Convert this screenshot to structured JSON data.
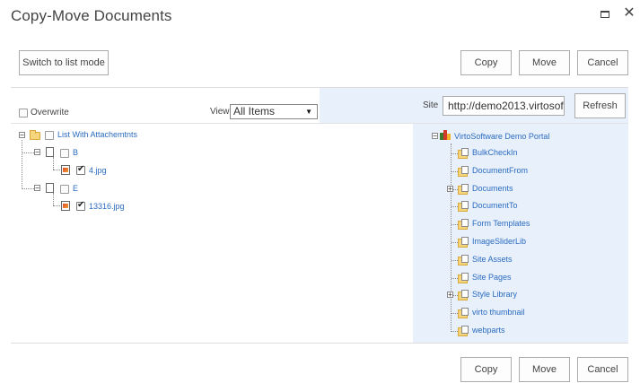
{
  "dialog": {
    "title": "Copy-Move Documents"
  },
  "toolbar": {
    "switch_label": "Switch to list mode",
    "copy_label": "Copy",
    "move_label": "Move",
    "cancel_label": "Cancel"
  },
  "footer": {
    "copy_label": "Copy",
    "move_label": "Move",
    "cancel_label": "Cancel"
  },
  "left": {
    "overwrite_label": "Overwrite",
    "view_label": "View",
    "view_value": "All Items",
    "tree": {
      "root": "List With Attachemtnts",
      "b": "B",
      "b_file": "4.jpg",
      "e": "E",
      "e_file": "13316.jpg"
    }
  },
  "right": {
    "site_label": "Site",
    "site_value": "http://demo2013.virtosof",
    "refresh_label": "Refresh",
    "root": "VirtoSoftware Demo Portal",
    "items": [
      "BulkCheckIn",
      "DocumentFrom",
      "Documents",
      "DocumentTo",
      "Form Templates",
      "ImageSliderLib",
      "Site Assets",
      "Site Pages",
      "Style Library",
      "virto thumbnail",
      "webparts"
    ]
  }
}
